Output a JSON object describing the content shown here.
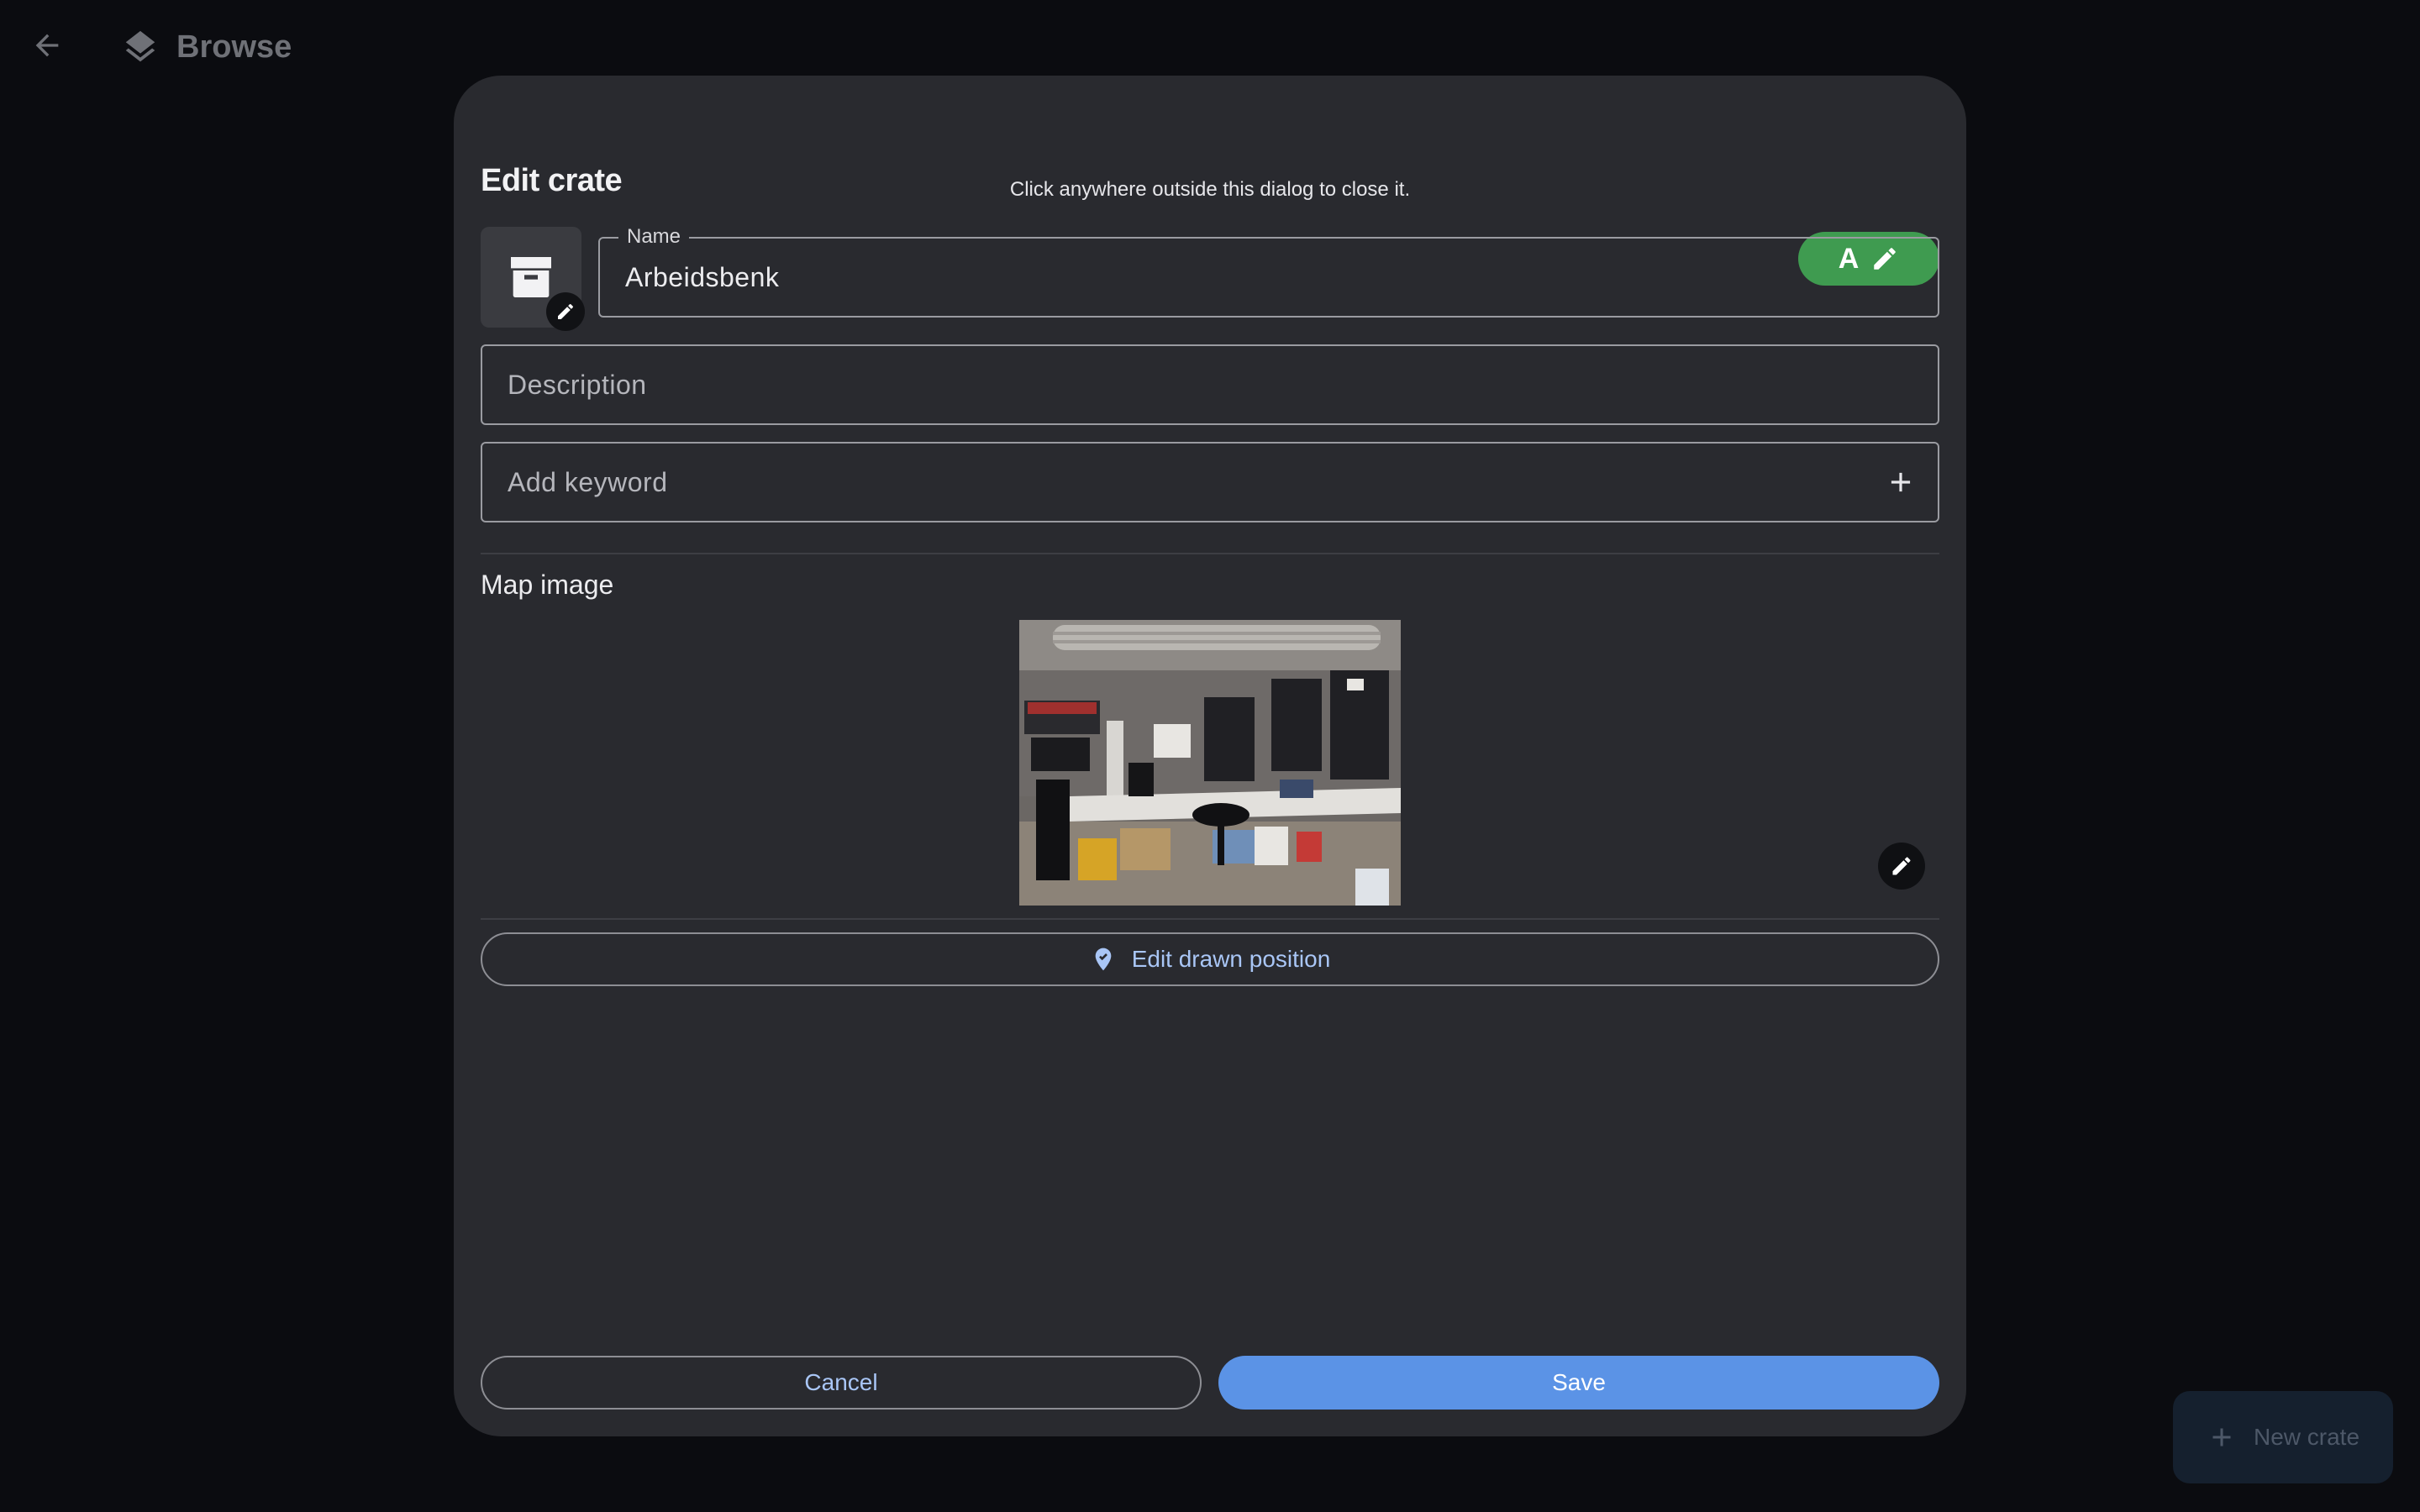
{
  "topbar": {
    "back_icon": "arrow-left-icon",
    "browse_icon": "layers-icon",
    "browse_label": "Browse"
  },
  "dialog": {
    "hint": "Click anywhere outside this dialog to close it.",
    "title": "Edit crate",
    "assignee_letter": "A",
    "crate_icon": "archive-box-icon",
    "name": {
      "label": "Name",
      "value": "Arbeidsbenk"
    },
    "description": {
      "placeholder": "Description"
    },
    "keyword": {
      "placeholder": "Add keyword"
    },
    "map_label": "Map image",
    "drawn_position_label": "Edit drawn position",
    "cancel_label": "Cancel",
    "save_label": "Save"
  },
  "fab": {
    "label": "New crate"
  },
  "colors": {
    "background": "#0b0c10",
    "dialog": "#292a2f",
    "assignee_green": "#3f9b50",
    "primary_blue": "#5b93e6",
    "link_blue": "#a9c6f6"
  }
}
